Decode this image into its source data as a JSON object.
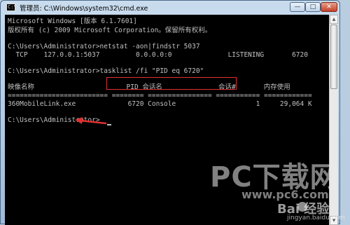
{
  "window": {
    "title": "管理员: C:\\Windows\\system32\\cmd.exe",
    "icon_text": "C:\\",
    "controls": {
      "minimize": "—",
      "maximize": "□",
      "close": "✕"
    }
  },
  "console": {
    "lines": [
      "Microsoft Windows [版本 6.1.7601]",
      "版权所有 (c) 2009 Microsoft Corporation。保留所有权利。",
      "C:\\Users\\Administrator>netstat -aon|findstr 5037",
      "  TCP    127.0.0.1:5037         0.0.0.0:0              LISTENING       6720",
      "C:\\Users\\Administrator>tasklist /fi \"PID eq 6720\"",
      "映像名称                       PID 会话名              会话#       内存使用",
      "========================= ======== ================ =========== ============",
      "360MobileLink.exe             6720 Console                    1     29,064 K",
      "C:\\Users\\Administrator>"
    ]
  },
  "watermark": {
    "main": "PC下载网",
    "url": "www.pc6.com",
    "baidu": "Bai  经验",
    "baidu_url": "jingyan.baidu.com"
  },
  "colors": {
    "console_bg": "#000000",
    "console_text": "#c0c0c0",
    "annotation": "#e03030"
  },
  "icons": [
    "cmd-icon",
    "minimize-icon",
    "maximize-icon",
    "close-icon",
    "arrow-left-icon"
  ]
}
